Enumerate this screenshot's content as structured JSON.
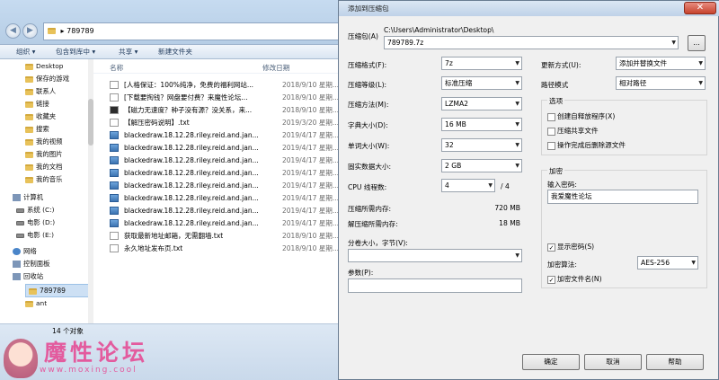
{
  "explorer": {
    "address": "789789",
    "toolbar": {
      "organize": "组织",
      "include_library": "包含到库中",
      "share": "共享",
      "new_folder": "新建文件夹"
    },
    "nav_items": [
      {
        "label": "Desktop",
        "icon": "folder-icon"
      },
      {
        "label": "保存的游戏",
        "icon": "folder-icon"
      },
      {
        "label": "联系人",
        "icon": "folder-icon"
      },
      {
        "label": "链接",
        "icon": "folder-icon"
      },
      {
        "label": "收藏夹",
        "icon": "folder-icon"
      },
      {
        "label": "搜索",
        "icon": "folder-icon"
      },
      {
        "label": "我的视频",
        "icon": "folder-icon"
      },
      {
        "label": "我的图片",
        "icon": "folder-icon"
      },
      {
        "label": "我的文档",
        "icon": "folder-icon"
      },
      {
        "label": "我的音乐",
        "icon": "folder-icon"
      },
      {
        "label": "计算机",
        "icon": "computer-icon"
      },
      {
        "label": "系统 (C:)",
        "icon": "drive-icon"
      },
      {
        "label": "电影 (D:)",
        "icon": "drive-icon"
      },
      {
        "label": "电影 (E:)",
        "icon": "drive-icon"
      },
      {
        "label": "网络",
        "icon": "network-icon"
      },
      {
        "label": "控制面板",
        "icon": "control-panel-icon"
      },
      {
        "label": "回收站",
        "icon": "recycle-bin-icon"
      },
      {
        "label": "789789",
        "icon": "folder-icon"
      },
      {
        "label": "ant",
        "icon": "folder-icon"
      }
    ],
    "columns": {
      "name": "名称",
      "date": "修改日期"
    },
    "files": [
      {
        "name": "[人格保证：100%纯净，免费的福利网站...",
        "date": "2018/9/10 星期...",
        "icon": "txt"
      },
      {
        "name": "[下载要掏钱？网盘要付费？来魔性论坛...",
        "date": "2018/9/10 星期...",
        "icon": "txt"
      },
      {
        "name": "【磁力无速度？种子没有源？没关系，来...",
        "date": "2018/9/10 星期...",
        "icon": "exe"
      },
      {
        "name": "【解压密码说明】.txt",
        "date": "2019/3/20 星期...",
        "icon": "txt"
      },
      {
        "name": "blackedraw.18.12.28.riley.reid.and.jan...",
        "date": "2019/4/17 星期...",
        "icon": "rar"
      },
      {
        "name": "blackedraw.18.12.28.riley.reid.and.jan...",
        "date": "2019/4/17 星期...",
        "icon": "rar"
      },
      {
        "name": "blackedraw.18.12.28.riley.reid.and.jan...",
        "date": "2019/4/17 星期...",
        "icon": "rar"
      },
      {
        "name": "blackedraw.18.12.28.riley.reid.and.jan...",
        "date": "2019/4/17 星期...",
        "icon": "rar"
      },
      {
        "name": "blackedraw.18.12.28.riley.reid.and.jan...",
        "date": "2019/4/17 星期...",
        "icon": "rar"
      },
      {
        "name": "blackedraw.18.12.28.riley.reid.and.jan...",
        "date": "2019/4/17 星期...",
        "icon": "rar"
      },
      {
        "name": "blackedraw.18.12.28.riley.reid.and.jan...",
        "date": "2019/4/17 星期...",
        "icon": "rar"
      },
      {
        "name": "blackedraw.18.12.28.riley.reid.and.jan...",
        "date": "2019/4/17 星期...",
        "icon": "rar"
      },
      {
        "name": "获取最新地址邮箱，无需翻墙.txt",
        "date": "2018/9/10 星期...",
        "icon": "txt"
      },
      {
        "name": "永久地址发布页.txt",
        "date": "2018/9/10 星期...",
        "icon": "txt"
      }
    ],
    "status": "14 个对象",
    "watermark": {
      "title": "魔性论坛",
      "url": "www.moxing.cool"
    }
  },
  "dialog": {
    "title": "添加到压缩包",
    "close": "✕",
    "archive_label": "压缩包(A)",
    "archive_path": "C:\\Users\\Administrator\\Desktop\\",
    "archive_name": "789789.7z",
    "browse": "...",
    "format_label": "压缩格式(F):",
    "format": "7z",
    "level_label": "压缩等级(L):",
    "level": "标准压缩",
    "method_label": "压缩方法(M):",
    "method": "LZMA2",
    "dict_label": "字典大小(D):",
    "dict": "16 MB",
    "word_label": "单词大小(W):",
    "word": "32",
    "solid_label": "固实数据大小:",
    "solid": "2 GB",
    "threads_label": "CPU 线程数:",
    "threads": "4",
    "threads_total": "/ 4",
    "mem_comp_label": "压缩所需内存:",
    "mem_comp": "720 MB",
    "mem_decomp_label": "解压缩所需内存:",
    "mem_decomp": "18 MB",
    "split_label": "分卷大小，字节(V):",
    "params_label": "参数(P):",
    "update_label": "更新方式(U):",
    "update": "添加并替换文件",
    "path_label": "路径模式",
    "path_mode": "相对路径",
    "options_title": "选项",
    "opt_sfx": "创建自释放程序(X)",
    "opt_shared": "压缩共享文件",
    "opt_delete": "操作完成后删除源文件",
    "encrypt_title": "加密",
    "password_label": "输入密码:",
    "password": "我爱魔性论坛",
    "show_password": "显示密码(S)",
    "algo_label": "加密算法:",
    "algo": "AES-256",
    "encrypt_names": "加密文件名(N)",
    "ok": "确定",
    "cancel": "取消",
    "help": "帮助"
  }
}
